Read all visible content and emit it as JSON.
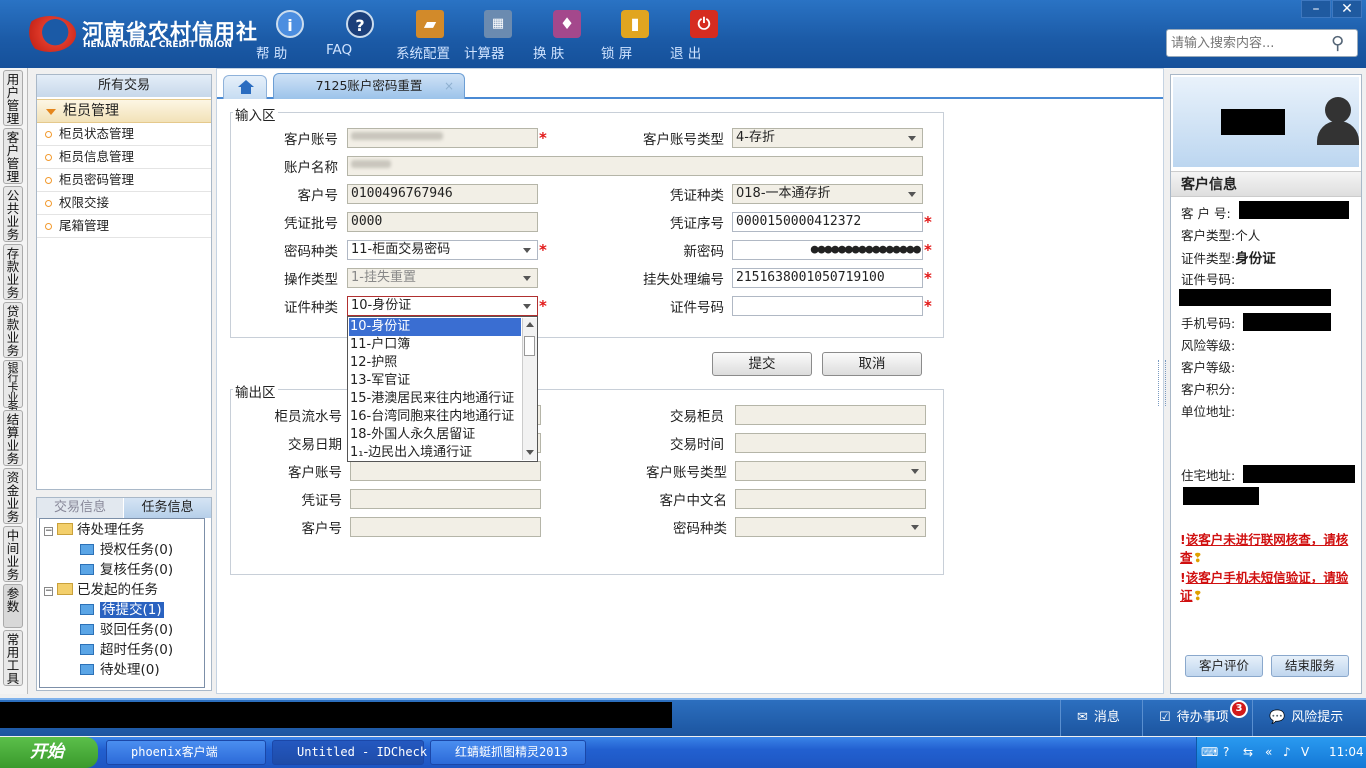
{
  "app": {
    "logo_cn": "河南省农村信用社",
    "logo_en": "HENAN RURAL CREDIT UNION",
    "toolbar": [
      {
        "label": "帮 助",
        "icon": "info-icon"
      },
      {
        "label": "FAQ",
        "icon": "question-icon"
      },
      {
        "label": "系统配置",
        "icon": "toolbox-icon"
      },
      {
        "label": "计算器",
        "icon": "calculator-icon"
      },
      {
        "label": "换 肤",
        "icon": "shirt-icon"
      },
      {
        "label": "锁 屏",
        "icon": "lock-icon"
      },
      {
        "label": "退 出",
        "icon": "power-icon"
      }
    ],
    "search_placeholder": "请输入搜索内容...",
    "win": {
      "minimize": "–",
      "close": "✕"
    }
  },
  "vnav": [
    "用户管理",
    "客户管理",
    "公共业务",
    "存款业务",
    "贷款业务",
    "银行卡业务",
    "结算业务",
    "资金业务",
    "中间业务",
    "参数",
    "常用工具"
  ],
  "sidebar": {
    "header": "所有交易",
    "group": "柜员管理",
    "items": [
      "柜员状态管理",
      "柜员信息管理",
      "柜员密码管理",
      "权限交接",
      "尾箱管理"
    ]
  },
  "tasks": {
    "tab1": "交易信息",
    "tab2": "任务信息",
    "tree": [
      {
        "label": "待处理任务",
        "level": 0
      },
      {
        "label": "授权任务(0)",
        "level": 1
      },
      {
        "label": "复核任务(0)",
        "level": 1
      },
      {
        "label": "已发起的任务",
        "level": 0
      },
      {
        "label": "待提交(1)",
        "level": 1
      },
      {
        "label": "驳回任务(0)",
        "level": 1
      },
      {
        "label": "超时任务(0)",
        "level": 1
      },
      {
        "label": "待处理(0)",
        "level": 1
      }
    ]
  },
  "tab": {
    "title": "7125账户密码重置",
    "close": "×"
  },
  "input_area": {
    "legend": "输入区",
    "customer_account": {
      "label": "客户账号"
    },
    "account_type": {
      "label": "客户账号类型",
      "value": "4-存折"
    },
    "account_name": {
      "label": "账户名称"
    },
    "customer_no": {
      "label": "客户号",
      "value": "0100496767946"
    },
    "voucher_type": {
      "label": "凭证种类",
      "value": "018-一本通存折"
    },
    "voucher_batch": {
      "label": "凭证批号",
      "value": "0000"
    },
    "voucher_seq": {
      "label": "凭证序号",
      "value": "0000150000412372"
    },
    "pwd_type": {
      "label": "密码种类",
      "value": "11-柜面交易密码"
    },
    "new_pwd": {
      "label": "新密码",
      "value": "●●●●●●●●●●●●●●●●"
    },
    "op_type": {
      "label": "操作类型",
      "value": "1-挂失重置"
    },
    "loss_no": {
      "label": "挂失处理编号",
      "value": "2151638001050719100"
    },
    "id_type": {
      "label": "证件种类",
      "value": "10-身份证"
    },
    "id_no": {
      "label": "证件号码",
      "value": ""
    },
    "submit": "提交",
    "cancel": "取消"
  },
  "dropdown_options": [
    "10-身份证",
    "11-户口簿",
    "12-护照",
    "13-军官证",
    "15-港澳居民来往内地通行证",
    "16-台湾同胞来往内地通行证",
    "18-外国人永久居留证",
    "1₁-边民出入境通行证"
  ],
  "output_area": {
    "legend": "输出区",
    "labels": {
      "teller_seq": "柜员流水号",
      "trade_teller": "交易柜员",
      "trade_date": "交易日期",
      "trade_time": "交易时间",
      "cust_acct": "客户账号",
      "cust_acct_type": "客户账号类型",
      "voucher_no": "凭证号",
      "cust_cn_name": "客户中文名",
      "cust_no": "客户号",
      "pwd_type": "密码种类"
    }
  },
  "customer": {
    "title": "客户信息",
    "labels": {
      "cust_no": "客 户 号:",
      "cust_type": "客户类型:",
      "id_type": "证件类型:",
      "id_no": "证件号码:",
      "phone": "手机号码:",
      "risk": "风险等级:",
      "level": "客户等级:",
      "points": "客户积分:",
      "company": "单位地址:",
      "home": "住宅地址:"
    },
    "cust_type_value": "个人",
    "id_type_value": "身份证",
    "warn1": "该客户未进行联网核查，请核查",
    "warn2": "该客户手机未短信验证，请验证",
    "btn_eval": "客户评价",
    "btn_end": "结束服务"
  },
  "statusbar": {
    "msg": "消息",
    "todo": "待办事项",
    "todo_count": "3",
    "risk": "风险提示"
  },
  "taskbar": {
    "start": "开始",
    "tasks": [
      "phoenix客户端",
      "Untitled - IDCheck",
      "红蜻蜓抓图精灵2013"
    ],
    "clock": "11:04"
  }
}
